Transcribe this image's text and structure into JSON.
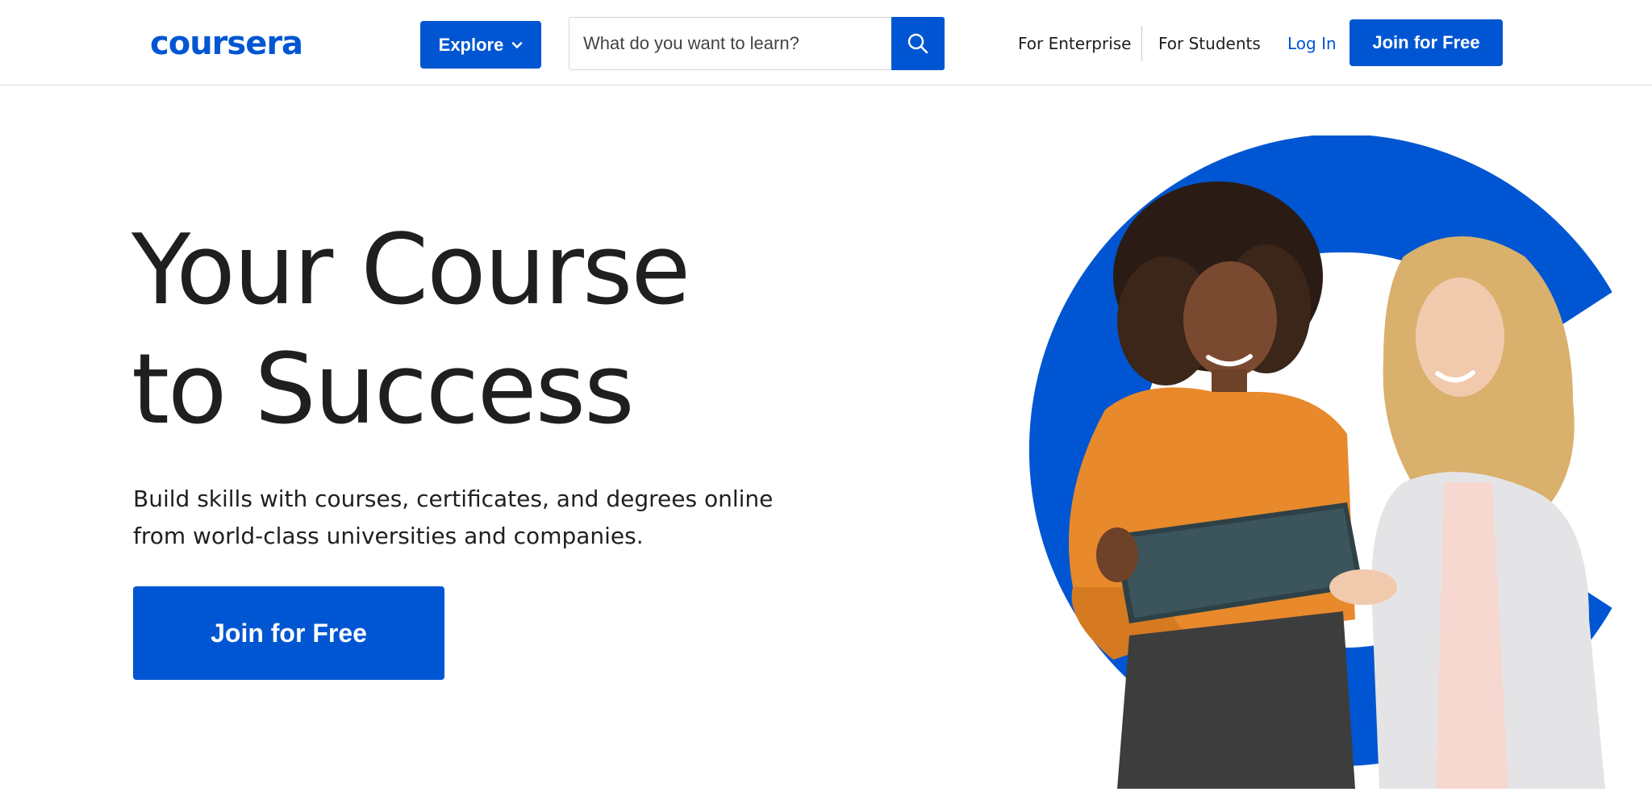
{
  "header": {
    "logo": "coursera",
    "explore_label": "Explore",
    "search": {
      "placeholder": "What do you want to learn?",
      "value": ""
    },
    "nav": {
      "enterprise": "For Enterprise",
      "students": "For Students",
      "login": "Log In"
    },
    "join_label": "Join for Free"
  },
  "hero": {
    "title_line1": "Your Course",
    "title_line2": "to Success",
    "subtitle_line1": "Build skills with courses, certificates, and degrees online",
    "subtitle_line2": "from world-class universities and companies.",
    "cta_label": "Join for Free"
  },
  "icons": {
    "explore_chevron": "chevron-down-icon",
    "search": "search-icon"
  },
  "colors": {
    "brand": "#0056d2",
    "text": "#1f1f1f",
    "sweater": "#e8892b",
    "blazer": "#e4e4e6"
  }
}
